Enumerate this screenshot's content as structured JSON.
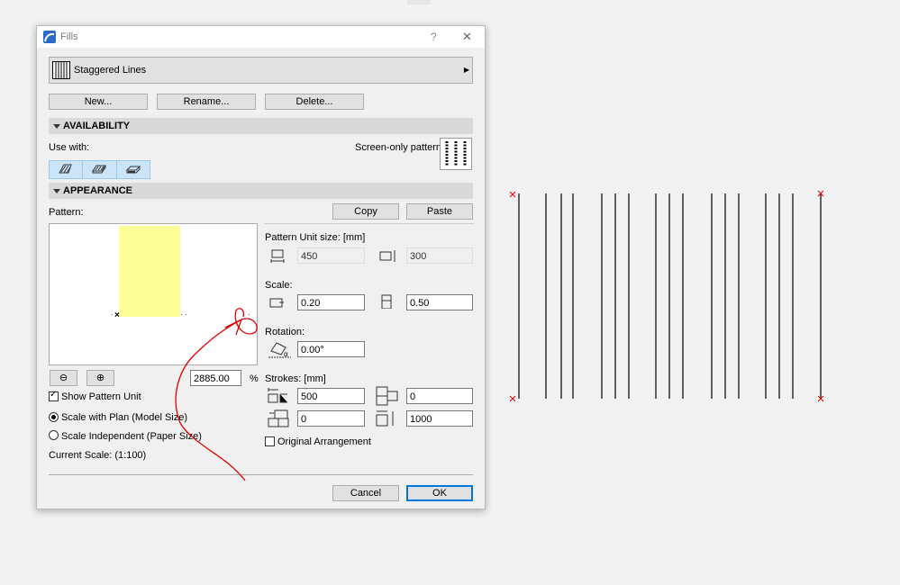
{
  "dialog": {
    "title": "Fills",
    "help": "?",
    "close": "✕",
    "fill_name": "Staggered Lines",
    "buttons": {
      "new": "New...",
      "rename": "Rename...",
      "delete": "Delete..."
    },
    "availability": {
      "header": "AVAILABILITY",
      "use_with": "Use with:",
      "screen_only": "Screen-only pattern:"
    },
    "appearance": {
      "header": "APPEARANCE",
      "pattern": "Pattern:",
      "copy": "Copy",
      "paste": "Paste",
      "zoom_value": "2885.00",
      "zoom_unit": "%",
      "show_pattern_unit": "Show Pattern Unit",
      "scale_with_plan": "Scale with Plan (Model Size)",
      "scale_independent": "Scale Independent (Paper Size)",
      "current_scale": "Current Scale: (1:100)",
      "unit_size_label": "Pattern Unit size: [mm]",
      "unit_w": "450",
      "unit_h": "300",
      "scale_label": "Scale:",
      "scale_x": "0.20",
      "scale_y": "0.50",
      "rotation_label": "Rotation:",
      "rotation": "0.00°",
      "strokes_label": "Strokes: [mm]",
      "stroke_1": "500",
      "stroke_2": "0",
      "stroke_3": "0",
      "stroke_4": "1000",
      "original_arrangement": "Original Arrangement"
    },
    "cancel": "Cancel",
    "ok": "OK",
    "colors": {
      "accent": "#0078d7",
      "preview_fill": "#ffff99",
      "annotation": "#e00000"
    }
  }
}
